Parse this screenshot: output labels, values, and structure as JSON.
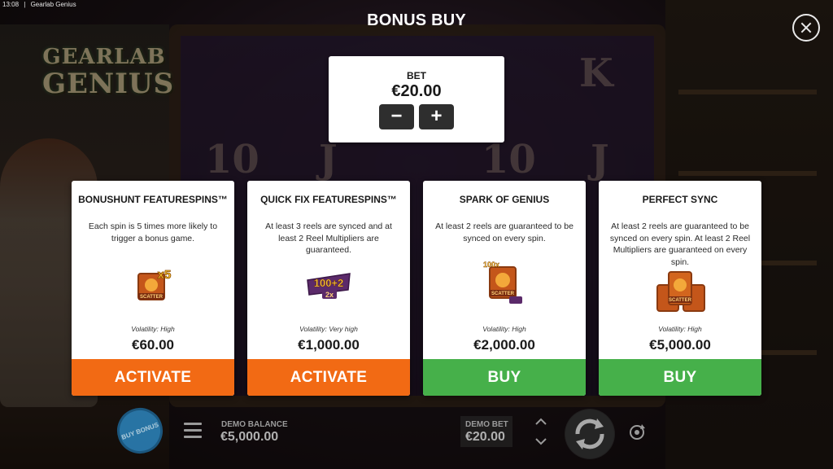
{
  "status_bar": {
    "time": "13:08",
    "app": "Gearlab Genius"
  },
  "logo": {
    "line1": "GEARLAB",
    "line2": "GENIUS"
  },
  "background_symbols": [
    "10",
    "J",
    "10",
    "J",
    "K"
  ],
  "overlay": {
    "title": "BONUS BUY",
    "close_icon": "close-icon"
  },
  "bet": {
    "label": "BET",
    "value": "€20.00",
    "minus_label": "−",
    "plus_label": "+"
  },
  "cards": [
    {
      "name": "BONUSHUNT FEATURESPINS™",
      "description": "Each spin is 5 times more likely to trigger a bonus game.",
      "icon_text": "x5",
      "icon_sub": "SCATTER",
      "volatility": "Volatility: High",
      "price": "€60.00",
      "action": "ACTIVATE",
      "action_color": "#f26a14"
    },
    {
      "name": "QUICK FIX FEATURESPINS™",
      "description": "At least 3 reels are synced and at least 2 Reel Multipliers are guaranteed.",
      "icon_text": "100+2",
      "icon_sub": "2x",
      "volatility": "Volatility: Very high",
      "price": "€1,000.00",
      "action": "ACTIVATE",
      "action_color": "#f26a14"
    },
    {
      "name": "SPARK OF GENIUS",
      "description": "At least 2 reels are guaranteed to be synced on every spin.",
      "icon_text": "100x",
      "icon_sub": "SCATTER",
      "volatility": "Volatility: High",
      "price": "€2,000.00",
      "action": "BUY",
      "action_color": "#46b04a"
    },
    {
      "name": "PERFECT SYNC",
      "description": "At least 2 reels are guaranteed to be synced on every spin. At least 2 Reel Multipliers are guaranteed on every spin.",
      "icon_text": "",
      "icon_sub": "SCATTER",
      "volatility": "Volatility: High",
      "price": "€5,000.00",
      "action": "BUY",
      "action_color": "#46b04a"
    }
  ],
  "bottom_bar": {
    "buy_bonus_label": "BUY BONUS",
    "demo_balance_label": "DEMO BALANCE",
    "demo_balance_value": "€5,000.00",
    "demo_bet_label": "DEMO BET",
    "demo_bet_value": "€20.00"
  }
}
